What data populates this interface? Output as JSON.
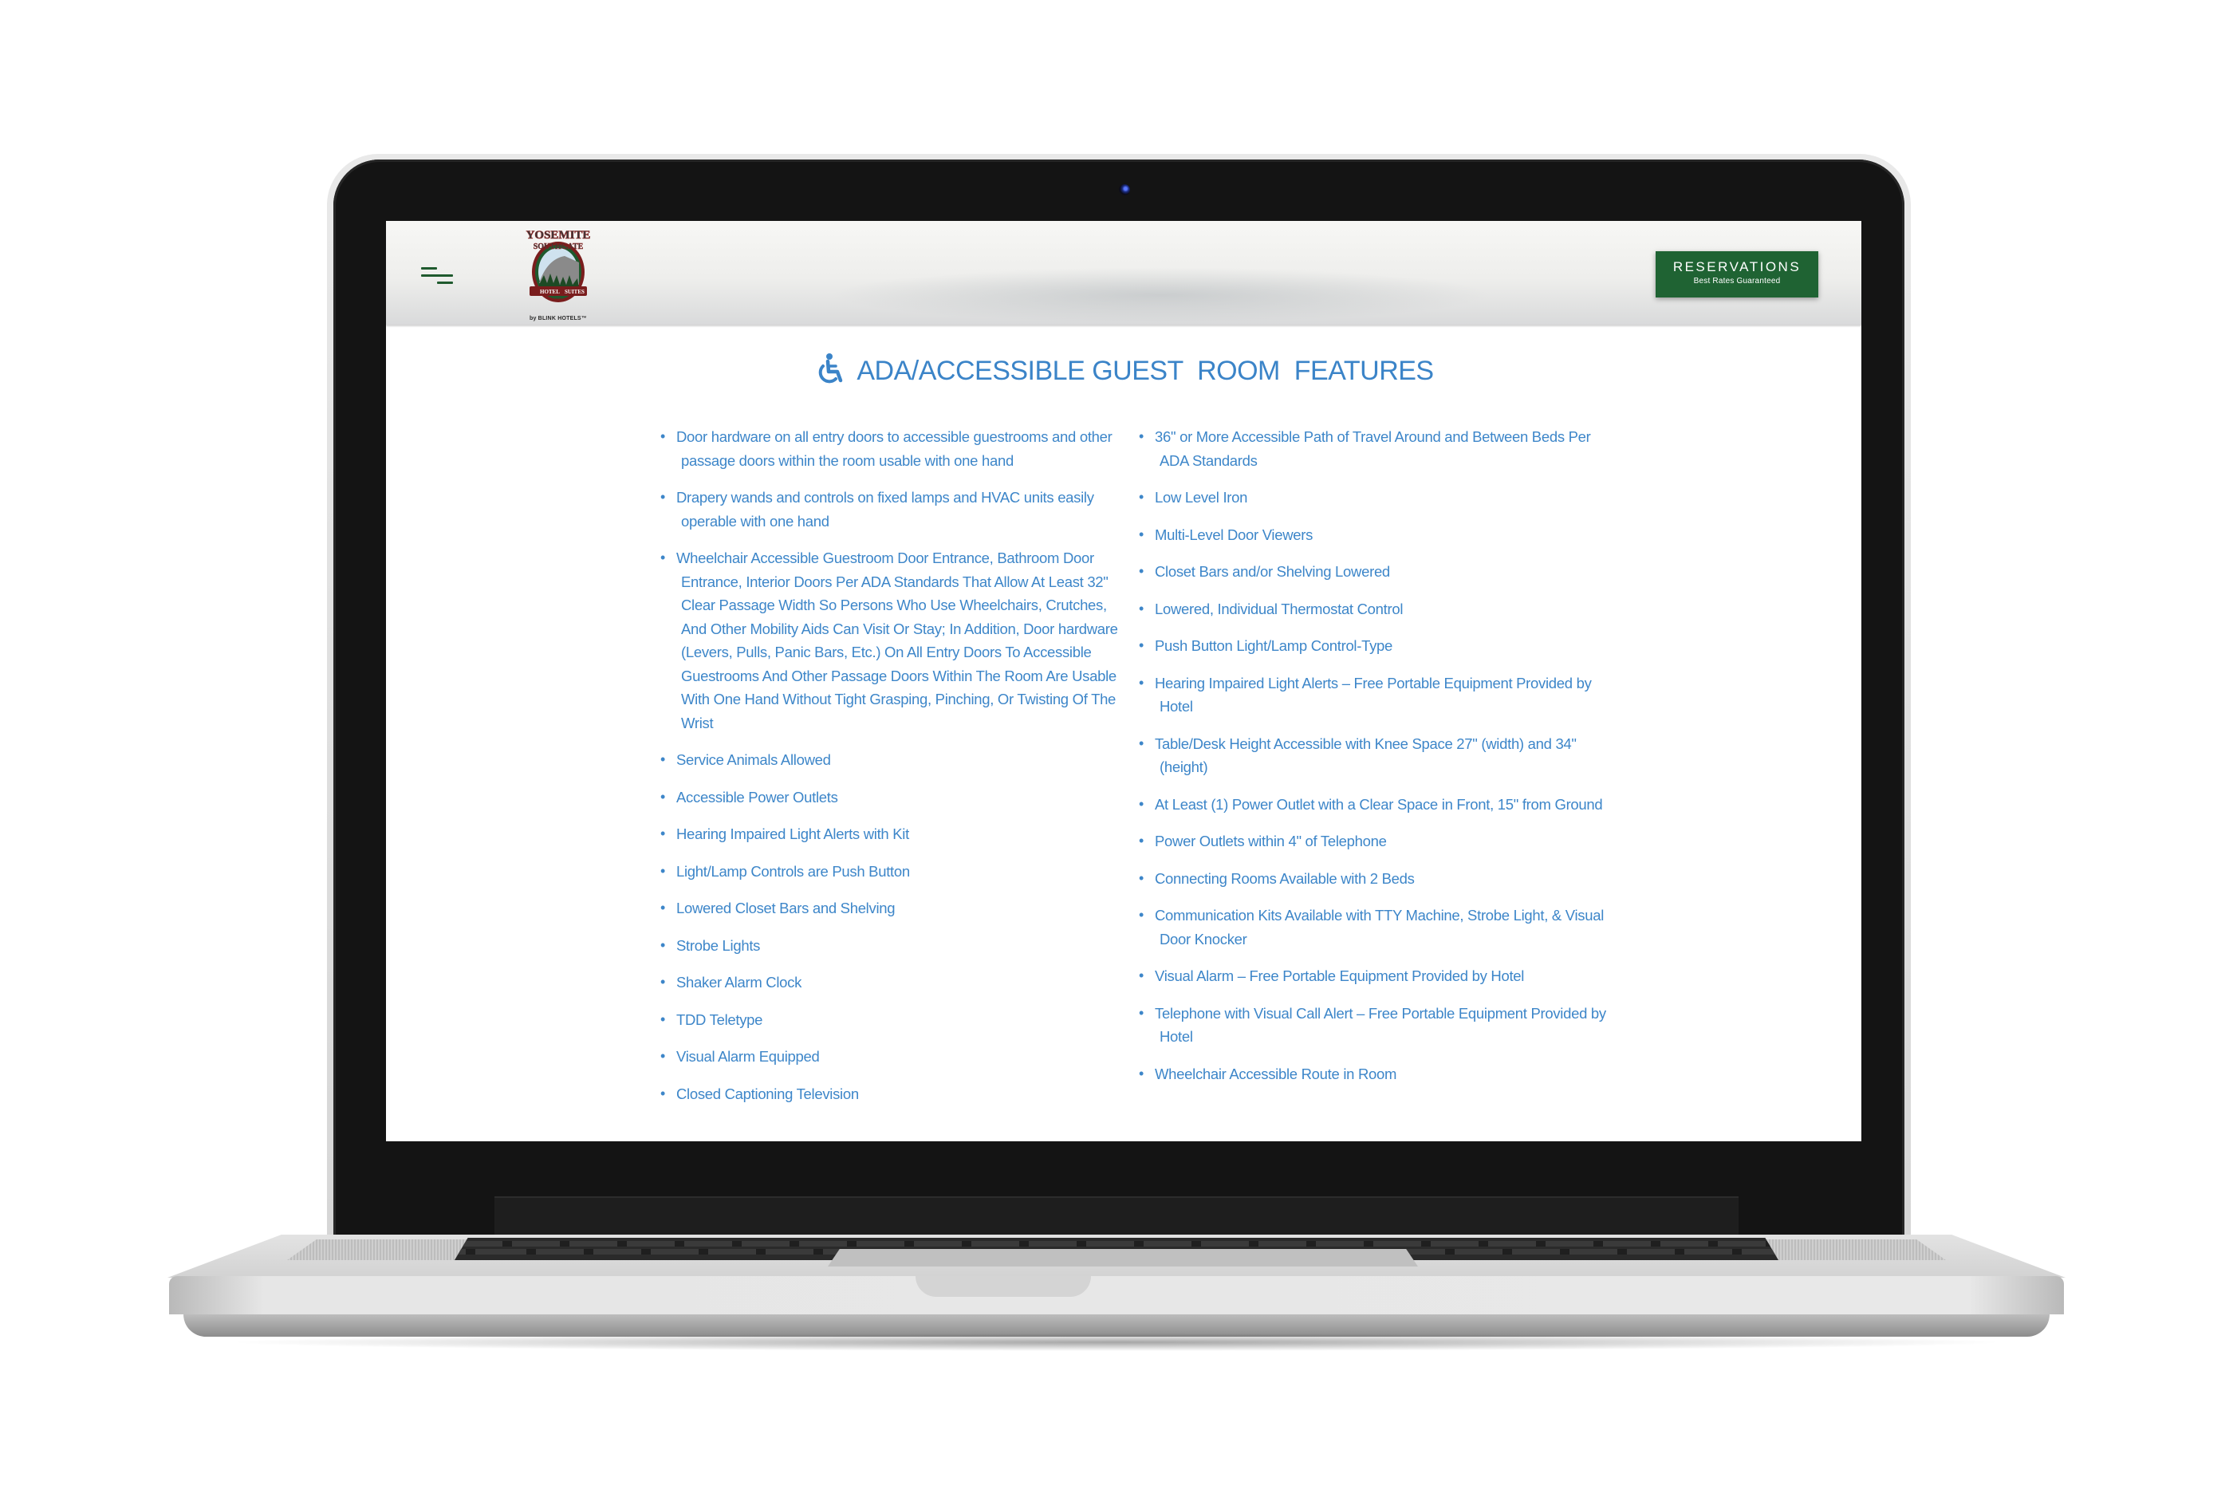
{
  "header": {
    "logo": {
      "name_line1": "YOSEMITE",
      "name_line2": "SOUTHGATE",
      "banner_left": "HOTEL",
      "banner_center": "AND",
      "banner_right": "SUITES",
      "tagline": "by BLINK HOTELS™"
    },
    "reservations_button": {
      "label": "RESERVATIONS",
      "sublabel": "Best Rates Guaranteed"
    },
    "colors": {
      "brand_green": "#1f6333",
      "accent_blue": "#3b84c8"
    }
  },
  "main": {
    "title": "ADA/ACCESSIBLE GUEST  ROOM  FEATURES",
    "title_icon": "wheelchair-icon",
    "left_features": [
      "Door hardware on all entry doors to accessible guestrooms and other passage doors within the room usable with one hand",
      "Drapery wands and controls on fixed lamps and HVAC units easily operable with one hand",
      "Wheelchair Accessible Guestroom Door Entrance, Bathroom Door Entrance, Interior Doors Per ADA Standards That Allow At Least 32\" Clear Passage Width So Persons Who Use Wheelchairs, Crutches, And Other Mobility Aids Can Visit Or Stay; In Addition, Door hardware (Levers, Pulls, Panic Bars, Etc.) On All Entry Doors To Accessible Guestrooms And Other Passage Doors Within The Room Are Usable With One Hand Without Tight Grasping, Pinching, Or Twisting Of The Wrist",
      "Service Animals Allowed",
      "Accessible Power Outlets",
      "Hearing Impaired Light Alerts with Kit",
      "Light/Lamp Controls are Push Button",
      "Lowered Closet Bars and Shelving",
      "Strobe Lights",
      "Shaker Alarm Clock",
      "TDD Teletype",
      "Visual Alarm Equipped",
      "Closed Captioning Television"
    ],
    "right_features": [
      "36\" or More Accessible Path of Travel Around and Between Beds Per ADA Standards",
      "Low Level Iron",
      "Multi-Level Door Viewers",
      "Closet Bars and/or Shelving Lowered",
      "Lowered, Individual Thermostat Control",
      "Push Button Light/Lamp Control-Type",
      "Hearing Impaired Light Alerts – Free Portable Equipment Provided by Hotel",
      "Table/Desk Height Accessible with Knee Space 27\" (width) and 34\" (height)",
      "At Least (1) Power Outlet with a Clear Space in Front, 15\" from Ground",
      "Power Outlets within 4\" of Telephone",
      "Connecting Rooms Available with 2 Beds",
      "Communication Kits Available with TTY Machine, Strobe Light, & Visual Door Knocker",
      "Visual Alarm – Free Portable Equipment Provided by Hotel",
      "Telephone with Visual Call Alert – Free Portable Equipment Provided by Hotel",
      "Wheelchair Accessible Route in Room"
    ]
  }
}
